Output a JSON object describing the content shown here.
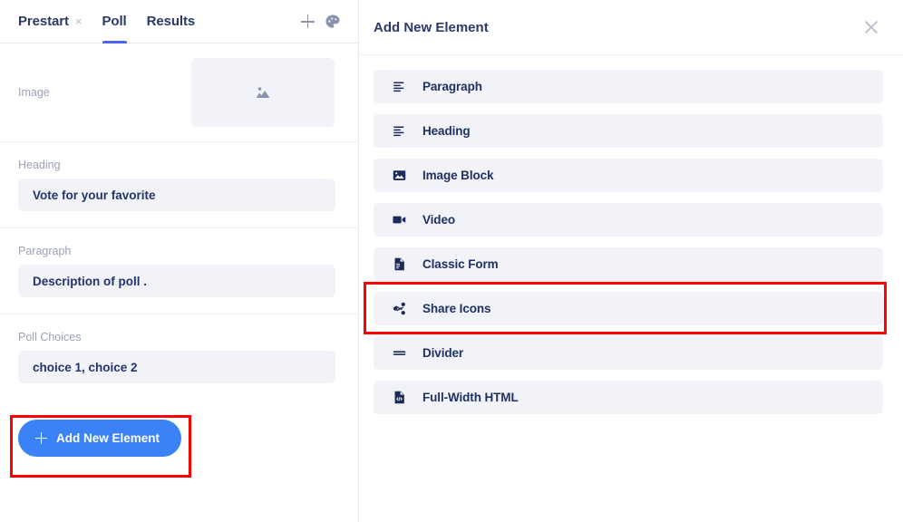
{
  "editor": {
    "tabs": [
      {
        "label": "Prestart",
        "closable": true,
        "active": false,
        "close_glyph": "×"
      },
      {
        "label": "Poll",
        "closable": false,
        "active": true
      },
      {
        "label": "Results",
        "closable": false,
        "active": false
      }
    ],
    "actions": {
      "add_tab_icon": "plus-icon",
      "theme_icon": "palette-icon"
    },
    "accent_color": "#4f66f4"
  },
  "form": {
    "fields": [
      {
        "label": "Image",
        "type": "image",
        "icon": "image-placeholder-icon",
        "value": ""
      },
      {
        "label": "Heading",
        "type": "text",
        "value": "Vote for your favorite"
      },
      {
        "label": "Paragraph",
        "type": "text",
        "value": "Description of poll ."
      },
      {
        "label": "Poll Choices",
        "type": "text",
        "value": "choice 1, choice 2"
      }
    ],
    "add_button": {
      "label": "Add New Element",
      "icon": "plus-icon",
      "color": "#3b82f6"
    }
  },
  "panel": {
    "title": "Add New Element",
    "close_icon": "close-icon",
    "items": [
      {
        "label": "Paragraph",
        "icon": "paragraph-icon"
      },
      {
        "label": "Heading",
        "icon": "heading-icon"
      },
      {
        "label": "Image Block",
        "icon": "image-icon"
      },
      {
        "label": "Video",
        "icon": "video-icon"
      },
      {
        "label": "Classic Form",
        "icon": "form-icon"
      },
      {
        "label": "Share Icons",
        "icon": "share-icon"
      },
      {
        "label": "Divider",
        "icon": "divider-icon"
      },
      {
        "label": "Full-Width HTML",
        "icon": "code-file-icon"
      }
    ]
  },
  "highlights": {
    "color": "#fe0000",
    "targets": [
      "add-new-element-button",
      "share-icons-item"
    ]
  }
}
